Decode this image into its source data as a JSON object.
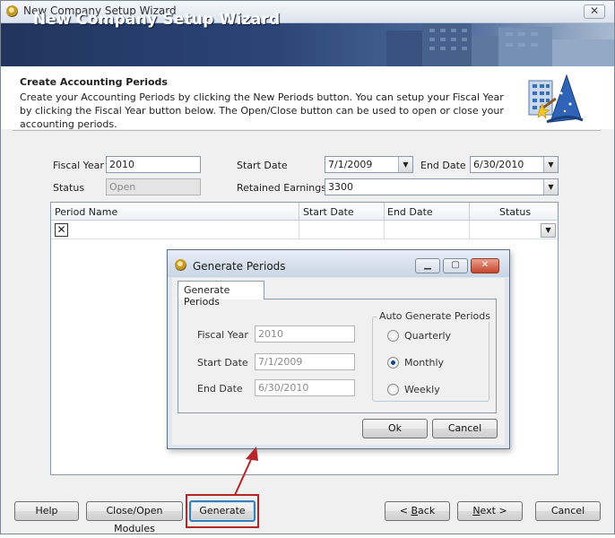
{
  "window": {
    "title": "New Company Setup Wizard"
  },
  "banner": {
    "title": "New Company Setup Wizard"
  },
  "header": {
    "section_title": "Create Accounting Periods",
    "description": "Create your Accounting Periods by clicking the New Periods button. You can setup your Fiscal Year by clicking the Fiscal Year button below. The Open/Close button can be used to open or close your accounting periods."
  },
  "form": {
    "fiscal_year_label": "Fiscal Year",
    "fiscal_year_value": "2010",
    "status_label": "Status",
    "status_value": "Open",
    "start_date_label": "Start Date",
    "start_date_value": "7/1/2009",
    "end_date_label": "End Date",
    "end_date_value": "6/30/2010",
    "retained_earnings_label": "Retained Earnings",
    "retained_earnings_value": "3300"
  },
  "grid": {
    "columns": [
      "Period Name",
      "Start Date",
      "End Date",
      "Status"
    ],
    "new_row_icon": "x-box-icon"
  },
  "dialog": {
    "title": "Generate Periods",
    "tab": "Generate Periods",
    "fiscal_year_label": "Fiscal Year",
    "fiscal_year_value": "2010",
    "start_date_label": "Start Date",
    "start_date_value": "7/1/2009",
    "end_date_label": "End Date",
    "end_date_value": "6/30/2010",
    "group_title": "Auto Generate Periods",
    "options": [
      "Quarterly",
      "Monthly",
      "Weekly"
    ],
    "selected_option": "Monthly",
    "ok_label": "Ok",
    "cancel_label": "Cancel"
  },
  "buttons": {
    "help": "Help",
    "close_open_modules": "Close/Open Modules",
    "generate": "Generate",
    "back_prefix": "< ",
    "back_mnemonic": "B",
    "back_rest": "ack",
    "next_mnemonic": "N",
    "next_rest": "ext >",
    "cancel": "Cancel"
  },
  "colors": {
    "highlight": "#b3262a",
    "banner": "#2b4578"
  }
}
